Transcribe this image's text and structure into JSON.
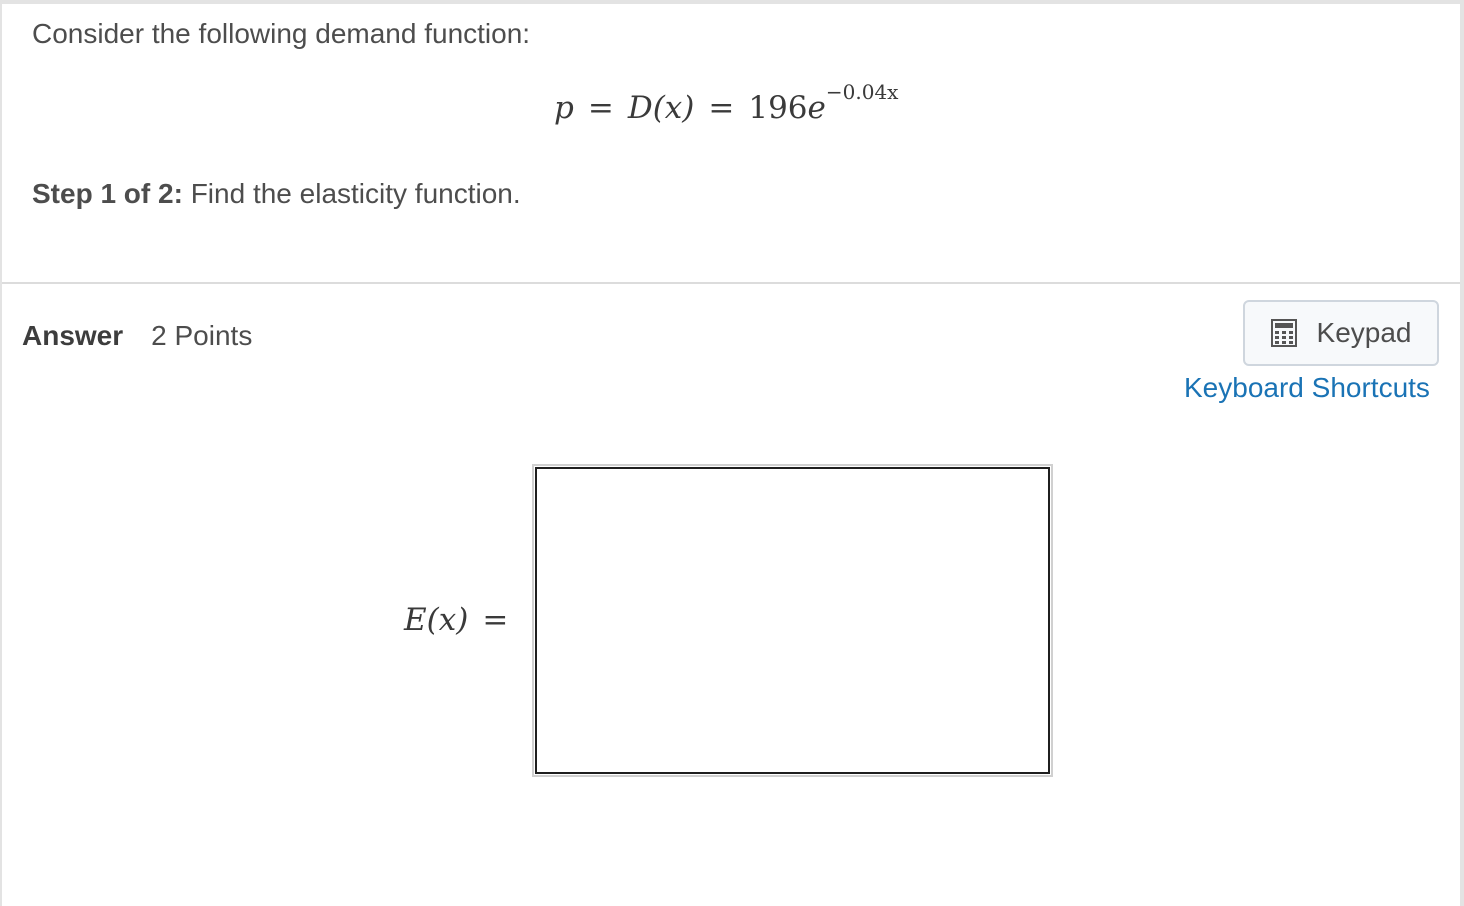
{
  "question": {
    "intro": "Consider the following demand function:",
    "equation": {
      "lhs": "p",
      "eq1": "=",
      "func": "D(x)",
      "eq2": "=",
      "coef": "196",
      "base": "e",
      "exponent": "−0.04x"
    },
    "step_prefix": "Step 1 of 2:",
    "step_text": " Find the elasticity function."
  },
  "answer": {
    "label": "Answer",
    "points": "2 Points",
    "keypad_label": "Keypad",
    "keypad_icon": "calculator-icon",
    "shortcuts_label": "Keyboard Shortcuts",
    "input_label_func": "E(x)",
    "input_label_eq": "=",
    "input_value": ""
  },
  "colors": {
    "link": "#1a73b5",
    "text": "#4d4d4d",
    "border": "#dcdcdc"
  }
}
